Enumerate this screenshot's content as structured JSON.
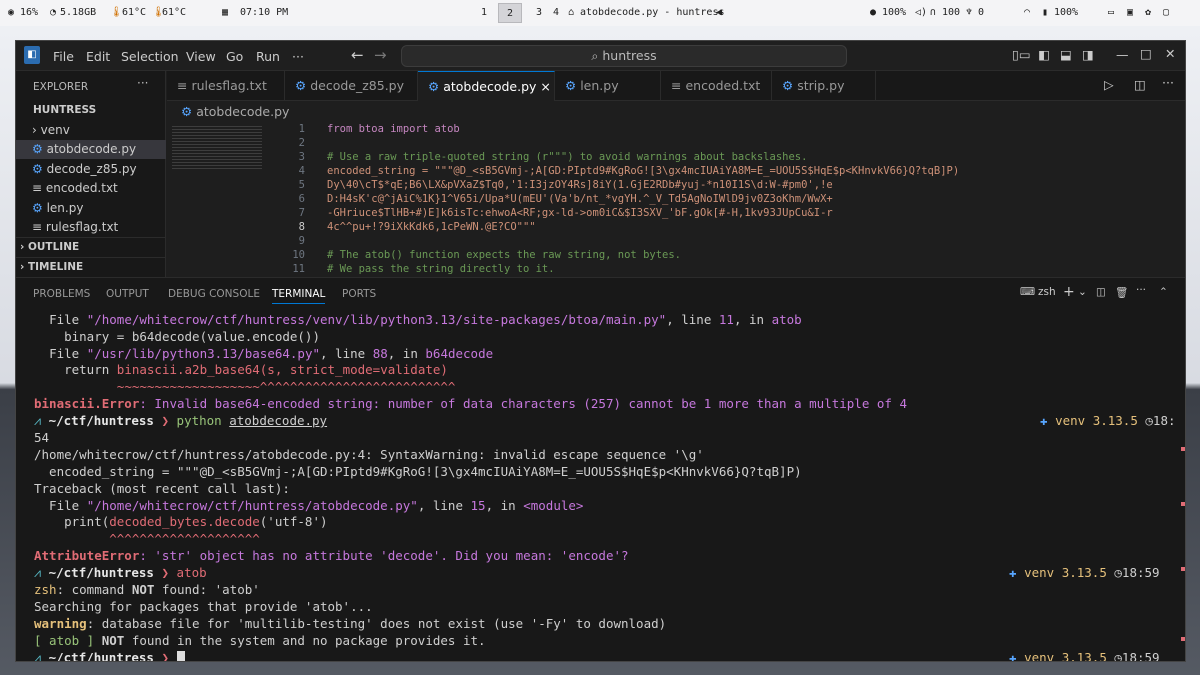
{
  "topbar": {
    "cpu": "16%",
    "mem": "5.18GB",
    "temp1": "61°C",
    "temp2": "61°C",
    "time": "07:10 PM",
    "workspaces": [
      "1",
      "2",
      "3",
      "4"
    ],
    "window_title": "atobdecode.py - huntress",
    "brightness": "100%",
    "volume": "100",
    "mic": "0",
    "battery": "100%"
  },
  "titlebar": {
    "menus": [
      "File",
      "Edit",
      "Selection",
      "View",
      "Go",
      "Run",
      "···"
    ],
    "search": "huntress"
  },
  "sidebar": {
    "header": "EXPLORER",
    "header_more": "···",
    "root": "HUNTRESS",
    "items": [
      {
        "label": "venv",
        "icon": "›"
      },
      {
        "label": "atobdecode.py",
        "icon": "⚙"
      },
      {
        "label": "decode_z85.py",
        "icon": "⚙"
      },
      {
        "label": "encoded.txt",
        "icon": "≡"
      },
      {
        "label": "len.py",
        "icon": "⚙"
      },
      {
        "label": "rulesflag.txt",
        "icon": "≡"
      }
    ],
    "outline": "OUTLINE",
    "timeline": "TIMELINE"
  },
  "tabs": [
    {
      "label": "rulesflag.txt",
      "icon": "≡"
    },
    {
      "label": "decode_z85.py",
      "icon": "⚙"
    },
    {
      "label": "atobdecode.py",
      "icon": "⚙",
      "close": "×"
    },
    {
      "label": "len.py",
      "icon": "⚙"
    },
    {
      "label": "encoded.txt",
      "icon": "≡"
    },
    {
      "label": "strip.py",
      "icon": "⚙"
    }
  ],
  "breadcrumb": "atobdecode.py",
  "editor": {
    "line_numbers": [
      "1",
      "2",
      "3",
      "4",
      "5",
      "6",
      "7",
      "8",
      "9",
      "10",
      "11"
    ],
    "lines": [
      "from btoa import atob",
      "",
      "# Use a raw triple-quoted string (r\"\"\") to avoid warnings about backslashes.",
      "encoded_string = \"\"\"@D_<sB5GVmj-;A[GD:PIptd9#KgRoG![3\\gx4mcIUAiYA8M=E_=UOU5S$HqE$p<KHnvkV66}Q?tqB]P)",
      "Dy\\40\\cT$*qE;B6\\LX&pVXaZ$Tq0,'1:I3jzOY4Rs]8iY(1.GjE2RDb#yuj-*n10I1S\\d:W-#pm0',!e",
      "D:H4sK'c@^jAiC%1K}1^V65i/Upa*U(mEU'(Va'b/nt_*vgYH.^_V_Td5AgNoIWlD9jv0Z3oKhm/WwX+",
      "-GHriuce$TlHB+#)E]k6isTc:ehwoA<RF;gx-ld->om0iC&$I3SXV_'bF.gOk[#-H,1kv93JUpCu&I-r",
      "4c^^pu+!?9iXkKdk6,1cPeWN.@E?CO\"\"\"",
      "",
      "# The atob() function expects the raw string, not bytes.",
      "# We pass the string directly to it."
    ]
  },
  "panel": {
    "tabs": [
      "PROBLEMS",
      "OUTPUT",
      "DEBUG CONSOLE",
      "TERMINAL",
      "PORTS"
    ],
    "shell": "zsh"
  },
  "terminal": {
    "l1_a": "File ",
    "l1_path": "\"/home/whitecrow/ctf/huntress/venv/lib/python3.13/site-packages/btoa/main.py\"",
    "l1_b": ", line ",
    "l1_num": "11",
    "l1_c": ", in ",
    "l1_fn": "atob",
    "l2": "binary = b64decode(value.encode())",
    "l3_a": "File ",
    "l3_path": "\"/usr/lib/python3.13/base64.py\"",
    "l3_b": ", line ",
    "l3_num": "88",
    "l3_c": ", in ",
    "l3_fn": "b64decode",
    "l4_a": "return ",
    "l4_b": "binascii.a2b_base64(s, strict_mode=validate)",
    "l5": "~~~~~~~~~~~~~~~~~~~^^^^^^^^^^^^^^^^^^^^^^^^^^",
    "l6_a": "binascii.Error",
    "l6_b": ": Invalid base64-encoded string: number of data characters (257) cannot be 1 more than a multiple of 4",
    "prompt1_path": "~/ctf/huntress",
    "prompt1_cmd": "python",
    "prompt1_arg": "atobdecode.py",
    "venv": "venv 3.13.5",
    "time1": "18:",
    "time2": "18:59",
    "time3": "18:59",
    "o1": "54",
    "o2": "/home/whitecrow/ctf/huntress/atobdecode.py:4: SyntaxWarning: invalid escape sequence '\\g'",
    "o3": "  encoded_string = \"\"\"@D_<sB5GVmj-;A[GD:PIptd9#KgRoG![3\\gx4mcIUAiYA8M=E_=UOU5S$HqE$p<KHnvkV66}Q?tqB]P)",
    "o4": "Traceback (most recent call last):",
    "o5_a": "  File ",
    "o5_path": "\"/home/whitecrow/ctf/huntress/atobdecode.py\"",
    "o5_b": ", line ",
    "o5_num": "15",
    "o5_c": ", in ",
    "o5_fn": "<module>",
    "o6_a": "    print(",
    "o6_b": "decoded_bytes.decode",
    "o6_c": "('utf-8')",
    "o7": "          ^^^^^^^^^^^^^^^^^^^^",
    "o8_a": "AttributeError",
    "o8_b": ": 'str' object has no attribute 'decode'. Did you mean: 'encode'?",
    "prompt2_path": "~/ctf/huntress",
    "prompt2_cmd": "atob",
    "o9_a": "zsh",
    "o9_b": ": command ",
    "o9_c": "NOT",
    "o9_d": " found: 'atob'",
    "o10": "Searching for packages that provide 'atob'...",
    "o11_a": "warning",
    "o11_b": ": database file for 'multilib-testing' does not exist (use '-Fy' to download)",
    "o12_a": "[ atob ] ",
    "o12_b": "NOT",
    "o12_c": " found in the system and no package provides it.",
    "prompt3_path": "~/ctf/huntress"
  },
  "colors": {
    "accent": "#0078d4",
    "error": "#e06c75",
    "path": "#c678dd",
    "venv": "#e5c07b"
  }
}
